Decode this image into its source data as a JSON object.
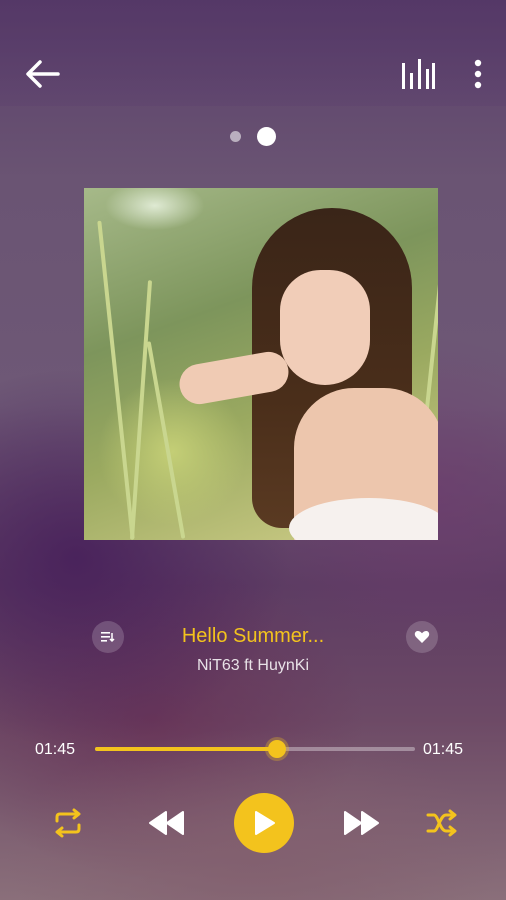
{
  "header": {
    "back_icon": "arrow-left-icon",
    "equalizer_icon": "equalizer-icon",
    "more_icon": "more-vertical-icon"
  },
  "pager": {
    "pages": 2,
    "active_index": 1
  },
  "track": {
    "title": "Hello Summer...",
    "artist": "NiT63 ft HuynKi",
    "queue_icon": "playlist-icon",
    "favorite_icon": "heart-icon"
  },
  "progress": {
    "current_time": "01:45",
    "duration": "01:45",
    "fraction": 0.57
  },
  "controls": {
    "repeat_icon": "repeat-icon",
    "previous_icon": "rewind-icon",
    "play_icon": "play-icon",
    "next_icon": "fast-forward-icon",
    "shuffle_icon": "shuffle-icon"
  },
  "colors": {
    "accent": "#f3c31d",
    "text": "#ffffff"
  }
}
